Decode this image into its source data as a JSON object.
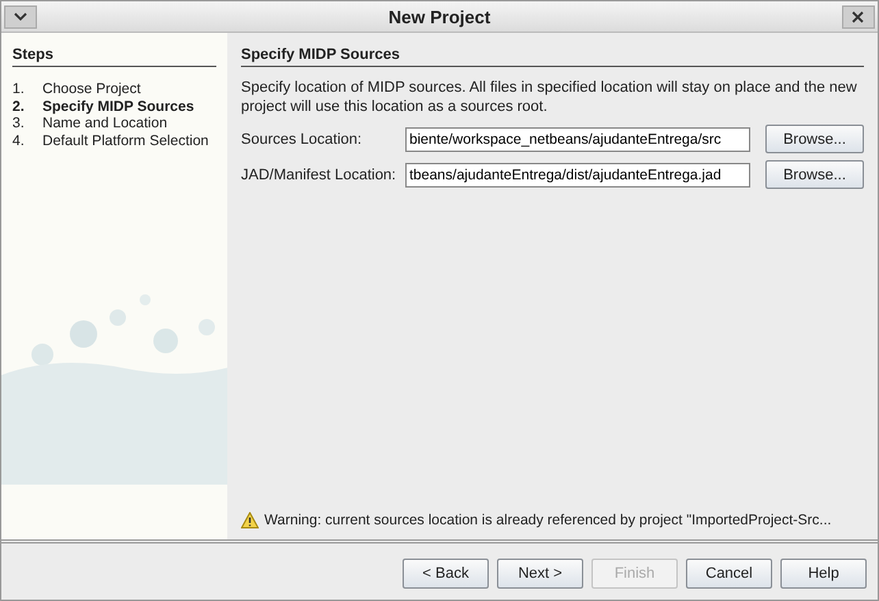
{
  "window": {
    "title": "New Project"
  },
  "steps": {
    "title": "Steps",
    "items": [
      {
        "number": "1.",
        "label": "Choose Project",
        "selected": false
      },
      {
        "number": "2.",
        "label": "Specify MIDP Sources",
        "selected": true
      },
      {
        "number": "3.",
        "label": "Name and Location",
        "selected": false
      },
      {
        "number": "4.",
        "label": "Default Platform Selection",
        "selected": false
      }
    ]
  },
  "panel": {
    "title": "Specify MIDP Sources",
    "description": "Specify location of MIDP sources. All files in specified location will stay on place and the new project will use this location as a sources root.",
    "fields": [
      {
        "label": "Sources Location:",
        "value": "biente/workspace_netbeans/ajudanteEntrega/src",
        "button": "Browse..."
      },
      {
        "label": "JAD/Manifest Location:",
        "value": "tbeans/ajudanteEntrega/dist/ajudanteEntrega.jad",
        "button": "Browse..."
      }
    ],
    "warning": "Warning: current sources location is already referenced by project \"ImportedProject-Src..."
  },
  "buttons": [
    {
      "label": "< Back",
      "disabled": false
    },
    {
      "label": "Next >",
      "disabled": false
    },
    {
      "label": "Finish",
      "disabled": true
    },
    {
      "label": "Cancel",
      "disabled": false
    },
    {
      "label": "Help",
      "disabled": false
    }
  ]
}
